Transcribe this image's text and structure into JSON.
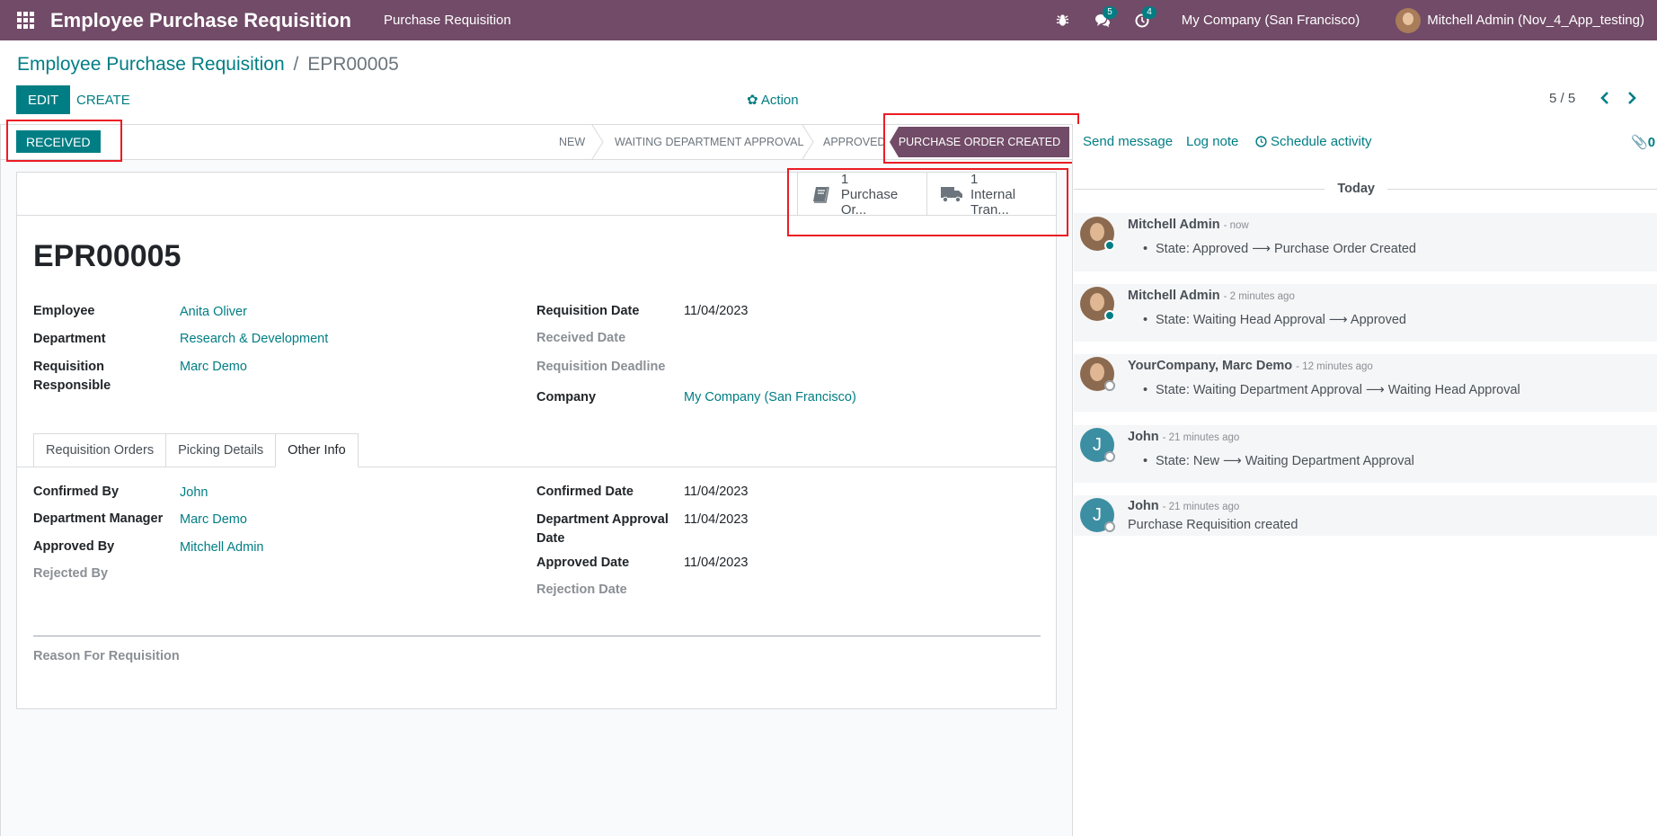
{
  "navbar": {
    "app_title": "Employee Purchase Requisition",
    "menu_item": "Purchase Requisition",
    "messages_count": "5",
    "activities_count": "4",
    "company": "My Company (San Francisco)",
    "user": "Mitchell Admin (Nov_4_App_testing)"
  },
  "breadcrumb": {
    "parent": "Employee Purchase Requisition",
    "separator": "/",
    "current": "EPR00005"
  },
  "buttons": {
    "edit": "EDIT",
    "create": "CREATE",
    "action": "✿ Action",
    "received": "RECEIVED"
  },
  "pager": {
    "value": "5 / 5"
  },
  "statusbar": {
    "stages": [
      "NEW",
      "WAITING DEPARTMENT APPROVAL",
      "APPROVED",
      "PURCHASE ORDER CREATED"
    ],
    "active_stage": "PURCHASE ORDER CREATED"
  },
  "smart_buttons": [
    {
      "count": "1",
      "label": "Purchase Or...",
      "icon": "book-icon"
    },
    {
      "count": "1",
      "label": "Internal Tran...",
      "icon": "truck-icon"
    }
  ],
  "record": {
    "title": "EPR00005",
    "employee_label": "Employee",
    "employee": "Anita Oliver",
    "department_label": "Department",
    "department": "Research & Development",
    "responsible_label_1": "Requisition",
    "responsible_label_2": "Responsible",
    "responsible": "Marc Demo",
    "req_date_label": "Requisition Date",
    "req_date": "11/04/2023",
    "received_date_label": "Received Date",
    "deadline_label": "Requisition Deadline",
    "company_label": "Company",
    "company": "My Company (San Francisco)"
  },
  "tabs": [
    "Requisition Orders",
    "Picking Details",
    "Other Info"
  ],
  "other_info": {
    "confirmed_by_label": "Confirmed By",
    "confirmed_by": "John",
    "dept_manager_label": "Department Manager",
    "dept_manager": "Marc Demo",
    "approved_by_label": "Approved By",
    "approved_by": "Mitchell Admin",
    "rejected_by_label": "Rejected By",
    "confirmed_date_label": "Confirmed Date",
    "confirmed_date": "11/04/2023",
    "dept_approval_label_1": "Department Approval",
    "dept_approval_label_2": "Date",
    "dept_approval_date": "11/04/2023",
    "approved_date_label": "Approved Date",
    "approved_date": "11/04/2023",
    "rejection_date_label": "Rejection Date",
    "reason_label": "Reason For Requisition"
  },
  "chatter": {
    "send_message": "Send message",
    "log_note": "Log note",
    "schedule_activity": "Schedule activity",
    "attachments": "0",
    "today": "Today",
    "messages": [
      {
        "author": "Mitchell Admin",
        "time": "- now",
        "body": "State: Approved ⟶ Purchase Order Created",
        "bullet": true
      },
      {
        "author": "Mitchell Admin",
        "time": "- 2 minutes ago",
        "body": "State: Waiting Head Approval ⟶ Approved",
        "bullet": true
      },
      {
        "author": "YourCompany, Marc Demo",
        "time": "- 12 minutes ago",
        "body": "State: Waiting Department Approval ⟶ Waiting Head Approval",
        "bullet": true
      },
      {
        "author": "John",
        "time": "- 21 minutes ago",
        "body": "State: New ⟶ Waiting Department Approval",
        "bullet": true
      },
      {
        "author": "John",
        "time": "- 21 minutes ago",
        "body": "Purchase Requisition created",
        "bullet": false
      }
    ]
  },
  "colors": {
    "brand": "#714b67",
    "accent": "#017e84",
    "highlight": "#ec1c24"
  }
}
